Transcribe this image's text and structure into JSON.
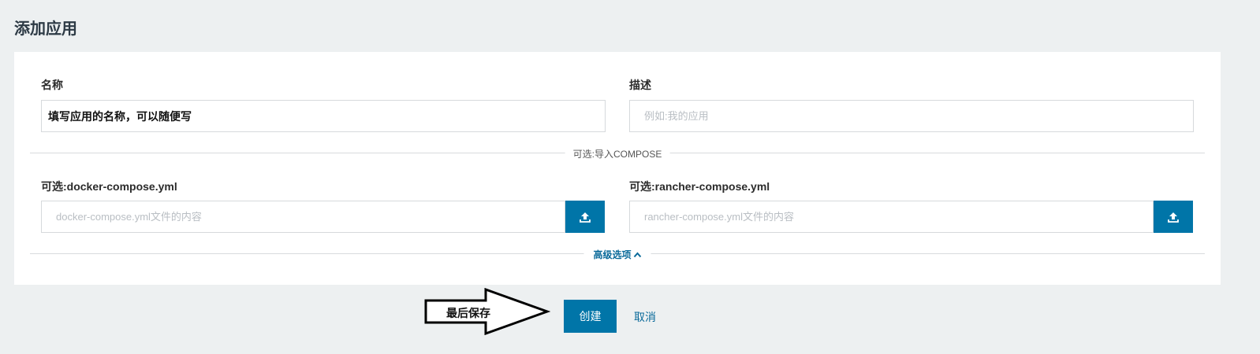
{
  "page": {
    "title": "添加应用"
  },
  "form": {
    "name_label": "名称",
    "name_value": "填写应用的名称，可以随便写",
    "description_label": "描述",
    "description_placeholder": "例如:我的应用",
    "compose_divider": "可选:导入COMPOSE",
    "docker_compose_label": "可选:docker-compose.yml",
    "docker_compose_placeholder": "docker-compose.yml文件的内容",
    "rancher_compose_label": "可选:rancher-compose.yml",
    "rancher_compose_placeholder": "rancher-compose.yml文件的内容",
    "advanced_label": "高级选项"
  },
  "actions": {
    "create_label": "创建",
    "cancel_label": "取消"
  },
  "annotation": {
    "text": "最后保存"
  },
  "colors": {
    "accent": "#0075a8",
    "link": "#0a6a9a",
    "background": "#edf0f1"
  },
  "icons": {
    "upload": "upload-icon",
    "advanced_toggle": "chevron-up-icon",
    "annotation": "arrow-right-icon"
  }
}
